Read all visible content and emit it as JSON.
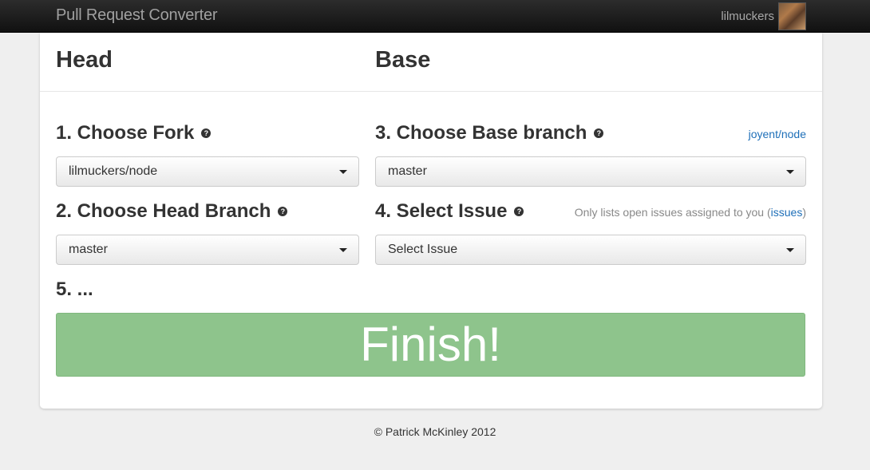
{
  "navbar": {
    "brand": "Pull Request Converter",
    "username": "lilmuckers"
  },
  "columns": {
    "head_title": "Head",
    "base_title": "Base"
  },
  "steps": {
    "fork": {
      "label": "1. Choose Fork",
      "help": "?",
      "selected": "lilmuckers/node"
    },
    "head_branch": {
      "label": "2. Choose Head Branch",
      "help": "?",
      "selected": "master"
    },
    "base_branch": {
      "label": "3. Choose Base branch",
      "help": "?",
      "selected": "master",
      "repo_link": "joyent/node"
    },
    "issue": {
      "label": "4. Select Issue",
      "help": "?",
      "selected": "Select Issue",
      "note_prefix": "Only lists open issues assigned to you (",
      "note_link": "issues",
      "note_suffix": ")"
    },
    "finish": {
      "label": "5. ...",
      "button": "Finish!"
    }
  },
  "colors": {
    "finish_button": "#8ec48c",
    "link": "#1e6fb8"
  },
  "footer": "© Patrick McKinley 2012"
}
